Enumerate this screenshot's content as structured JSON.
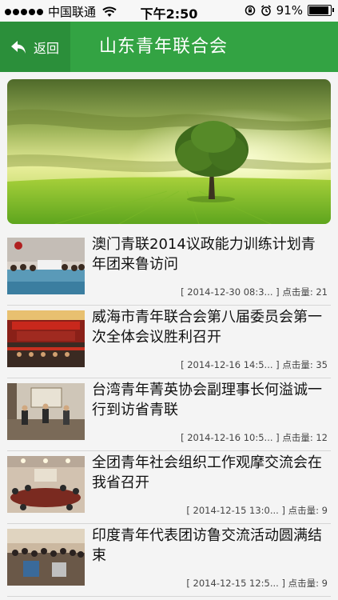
{
  "status_bar": {
    "carrier": "中国联通",
    "time": "下午2:50",
    "battery_percent": "91%",
    "battery_level": 0.91
  },
  "nav": {
    "back_label": "返回",
    "title": "山东青年联合会"
  },
  "colors": {
    "nav_green": "#33a343",
    "back_green": "#2b8f3a"
  },
  "articles": [
    {
      "title": "澳门青联2014议政能力训练计划青年团来鲁访问",
      "date": "[ 2014-12-30 08:3... ]",
      "views_label": "点击量:",
      "views": "21"
    },
    {
      "title": "威海市青年联合会第八届委员会第一次全体会议胜利召开",
      "date": "[ 2014-12-16 14:5... ]",
      "views_label": "点击量:",
      "views": "35"
    },
    {
      "title": "台湾青年菁英协会副理事长何溢诚一行到访省青联",
      "date": "[ 2014-12-16 10:5... ]",
      "views_label": "点击量:",
      "views": "12"
    },
    {
      "title": "全团青年社会组织工作观摩交流会在我省召开",
      "date": "[ 2014-12-15 13:0... ]",
      "views_label": "点击量:",
      "views": "9"
    },
    {
      "title": "印度青年代表团访鲁交流活动圆满结束",
      "date": "[ 2014-12-15 12:5... ]",
      "views_label": "点击量:",
      "views": "9"
    }
  ]
}
